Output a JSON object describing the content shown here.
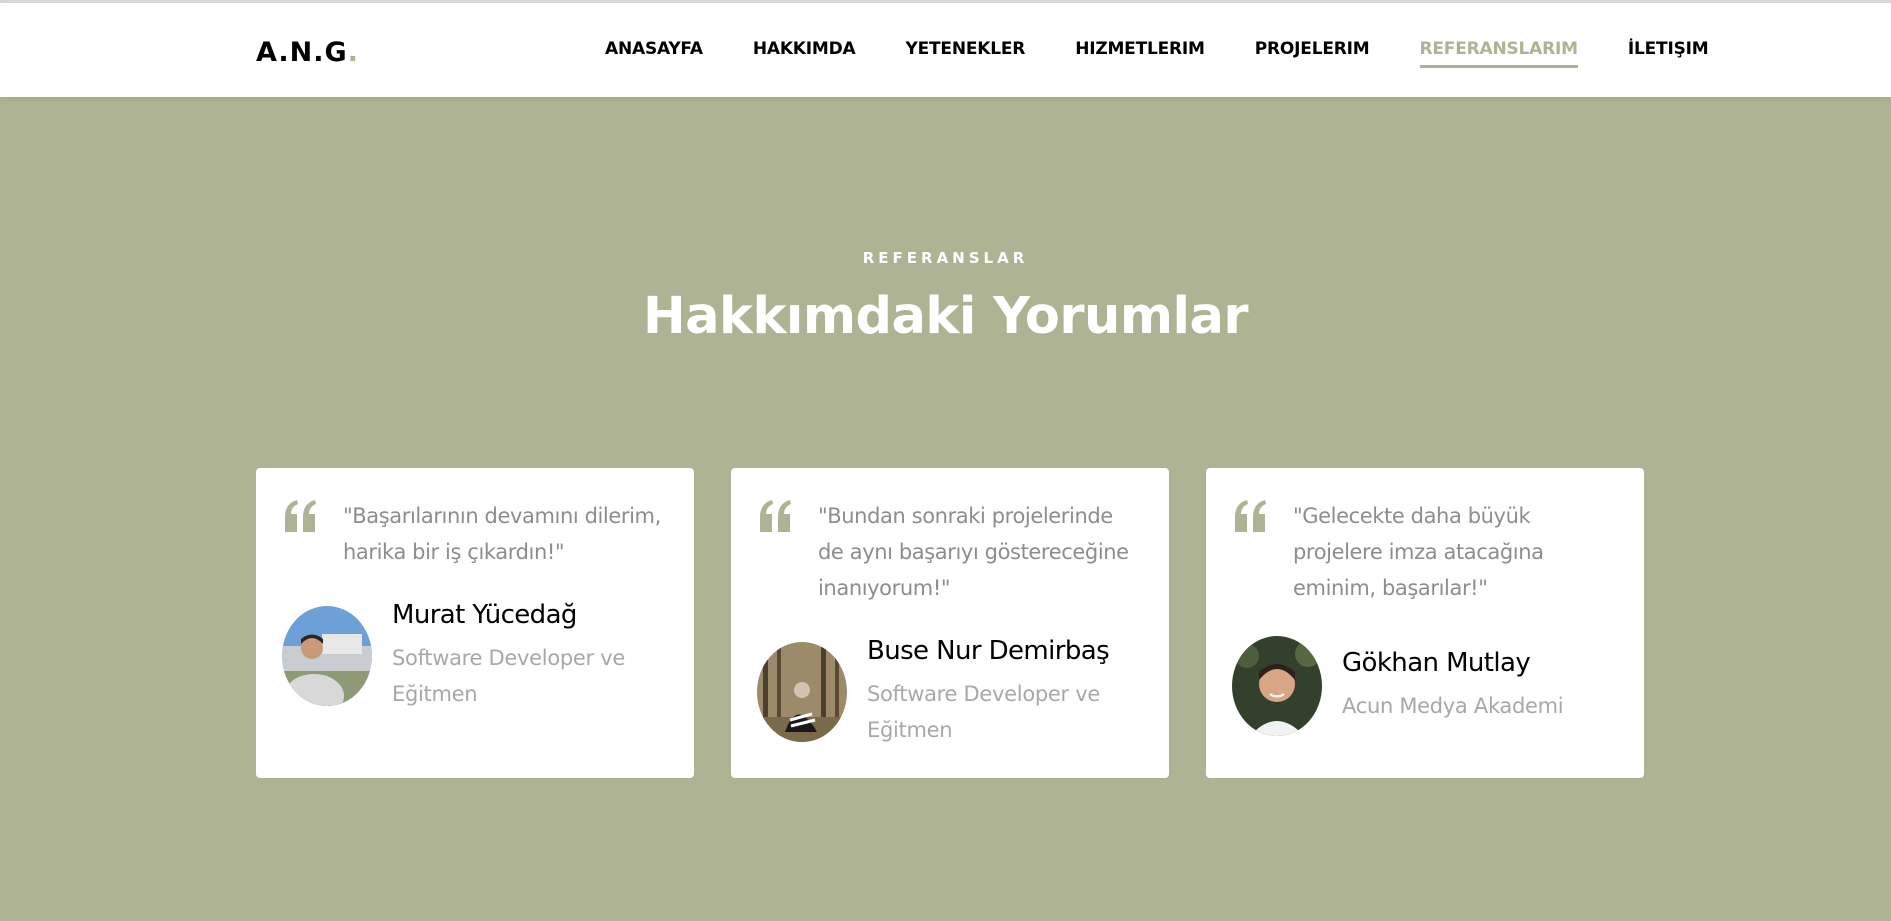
{
  "brand": {
    "logo_text": "A.N.G",
    "logo_dot": "."
  },
  "nav": {
    "items": [
      {
        "label": "ANASAYFA"
      },
      {
        "label": "HAKKIMDA"
      },
      {
        "label": "YETENEKLER"
      },
      {
        "label": "HIZMETLERIM"
      },
      {
        "label": "PROJELERIM"
      },
      {
        "label": "REFERANSLARIM",
        "active": true
      },
      {
        "label": "İLETIŞIM"
      }
    ]
  },
  "section": {
    "subtitle": "REFERANSLAR",
    "title": "Hakkımdaki Yorumlar"
  },
  "testimonials": [
    {
      "quote": "\"Başarılarının devamını dilerim, harika bir iş çıkardın!\"",
      "name": "Murat Yücedağ",
      "role": "Software Developer ve Eğitmen"
    },
    {
      "quote": "\"Bundan sonraki projelerinde de aynı başarıyı göstereceğine inanıyorum!\"",
      "name": "Buse Nur Demirbaş",
      "role": "Software Developer ve Eğitmen"
    },
    {
      "quote": "\"Gelecekte daha büyük projelere imza atacağına eminim, başarılar!\"",
      "name": "Gökhan Mutlay",
      "role": "Acun Medya Akademi"
    }
  ],
  "colors": {
    "accent": "#aeb493",
    "background": "#aeb493",
    "card": "#ffffff",
    "muted_text": "#8d8d8d"
  },
  "icons": {
    "quote": "quote-icon"
  }
}
